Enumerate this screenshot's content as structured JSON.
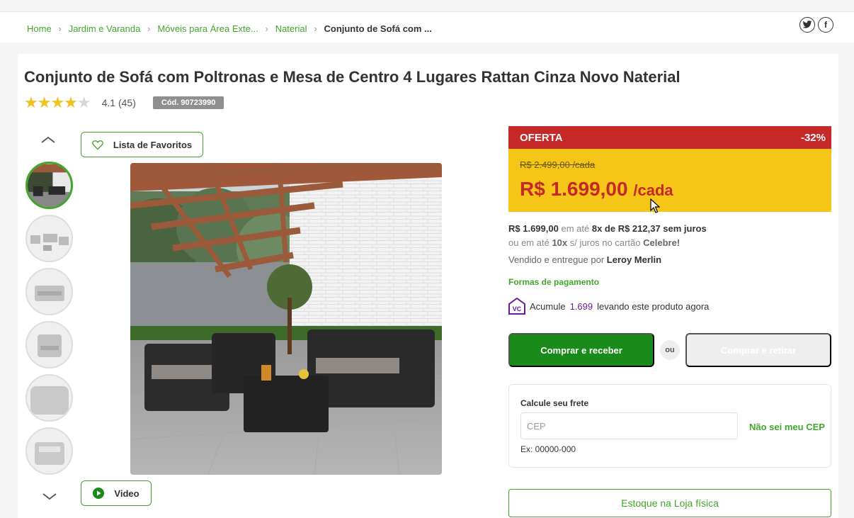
{
  "breadcrumb": [
    {
      "label": "Home"
    },
    {
      "label": "Jardim e Varanda"
    },
    {
      "label": "Móveis para Área Exte..."
    },
    {
      "label": "Naterial"
    },
    {
      "label": "Conjunto de Sofá com ..."
    }
  ],
  "social": {
    "twitter_icon": "twitter-icon",
    "facebook_icon": "facebook-icon"
  },
  "product": {
    "title": "Conjunto de Sofá com Poltronas e Mesa de Centro 4 Lugares Rattan Cinza Novo Naterial",
    "rating_value": 4.1,
    "rating_text": "4.1 (45)",
    "stars": "★★★★★",
    "sku": "Cód. 90723990"
  },
  "gallery": {
    "favorites_label": "Lista de Favoritos",
    "video_label": "Video"
  },
  "offer": {
    "label": "OFERTA",
    "discount": "-32%",
    "old_price": "R$ 2.499,00 /cada",
    "price": "R$ 1.699,00",
    "price_unit": "/cada",
    "colors": {
      "header": "#c62828",
      "body": "#f5c518"
    }
  },
  "payment": {
    "cash": "R$ 1.699,00",
    "or_until": "em até",
    "installments": "8x de R$ 212,37 sem juros",
    "card_prefix": "ou em até",
    "card_count": "10x",
    "card_mid": "s/ juros no cartão",
    "card_name": "Celebre!",
    "sold_by_prefix": "Vendido e entregue por",
    "seller": "Leroy Merlin",
    "methods_link": "Formas de pagamento",
    "loyalty_badge": "VC",
    "loyalty_prefix": "Acumule",
    "loyalty_points": "1.699",
    "loyalty_suffix": "levando este produto agora"
  },
  "actions": {
    "buy_label": "Comprar e receber",
    "or_label": "ou",
    "pickup_label": "Comprar e retirar",
    "stock_label": "Estoque na Loja física"
  },
  "freight": {
    "title": "Calcule seu frete",
    "placeholder": "CEP",
    "unknown_cep": "Não sei meu CEP",
    "hint": "Ex: 00000-000"
  },
  "colors": {
    "brand_green": "#41a62a",
    "buy_green": "#1a8a1a"
  }
}
